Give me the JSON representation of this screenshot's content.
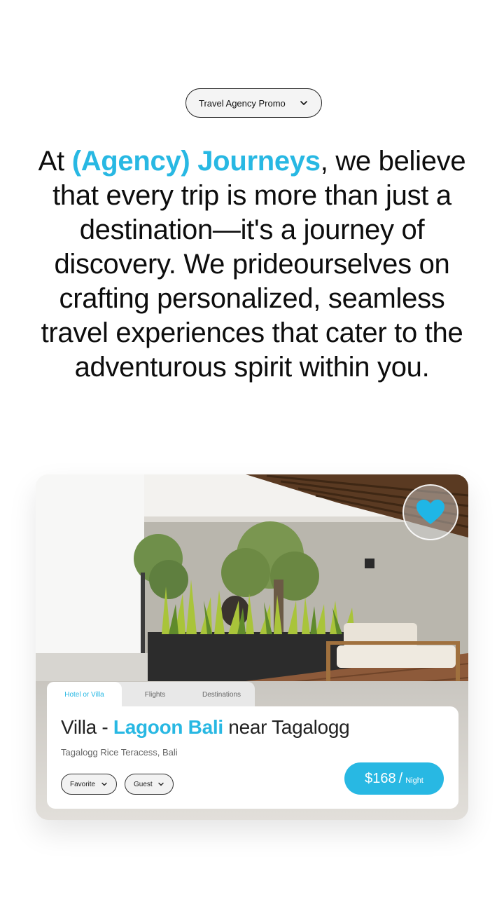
{
  "promo_selector": {
    "label": "Travel Agency Promo",
    "icon": "chevron-down-icon"
  },
  "headline": {
    "prefix": "At ",
    "agency": "(Agency) Journeys",
    "body": ", we believe that every trip is more than just a destination—it's a journey of discovery. We prideourselves on crafting personalized, seamless travel experiences that cater to the adventurous spirit within you."
  },
  "card": {
    "favorite_icon": "heart-icon",
    "tabs": [
      {
        "label": "Hotel or Villa",
        "active": true
      },
      {
        "label": "Flights",
        "active": false
      },
      {
        "label": "Destinations",
        "active": false
      }
    ],
    "title_prefix": "Villa - ",
    "title_accent": "Lagoon Bali",
    "title_suffix": " near Tagalogg",
    "location": "Tagalogg Rice Teracess, Bali",
    "filters": [
      {
        "label": "Favorite",
        "icon": "chevron-down-icon"
      },
      {
        "label": "Guest",
        "icon": "chevron-down-icon"
      }
    ],
    "price": {
      "amount": "$168",
      "separator": "/",
      "unit": "Night"
    }
  },
  "colors": {
    "accent": "#28b8e3",
    "text": "#0d0d0d"
  }
}
